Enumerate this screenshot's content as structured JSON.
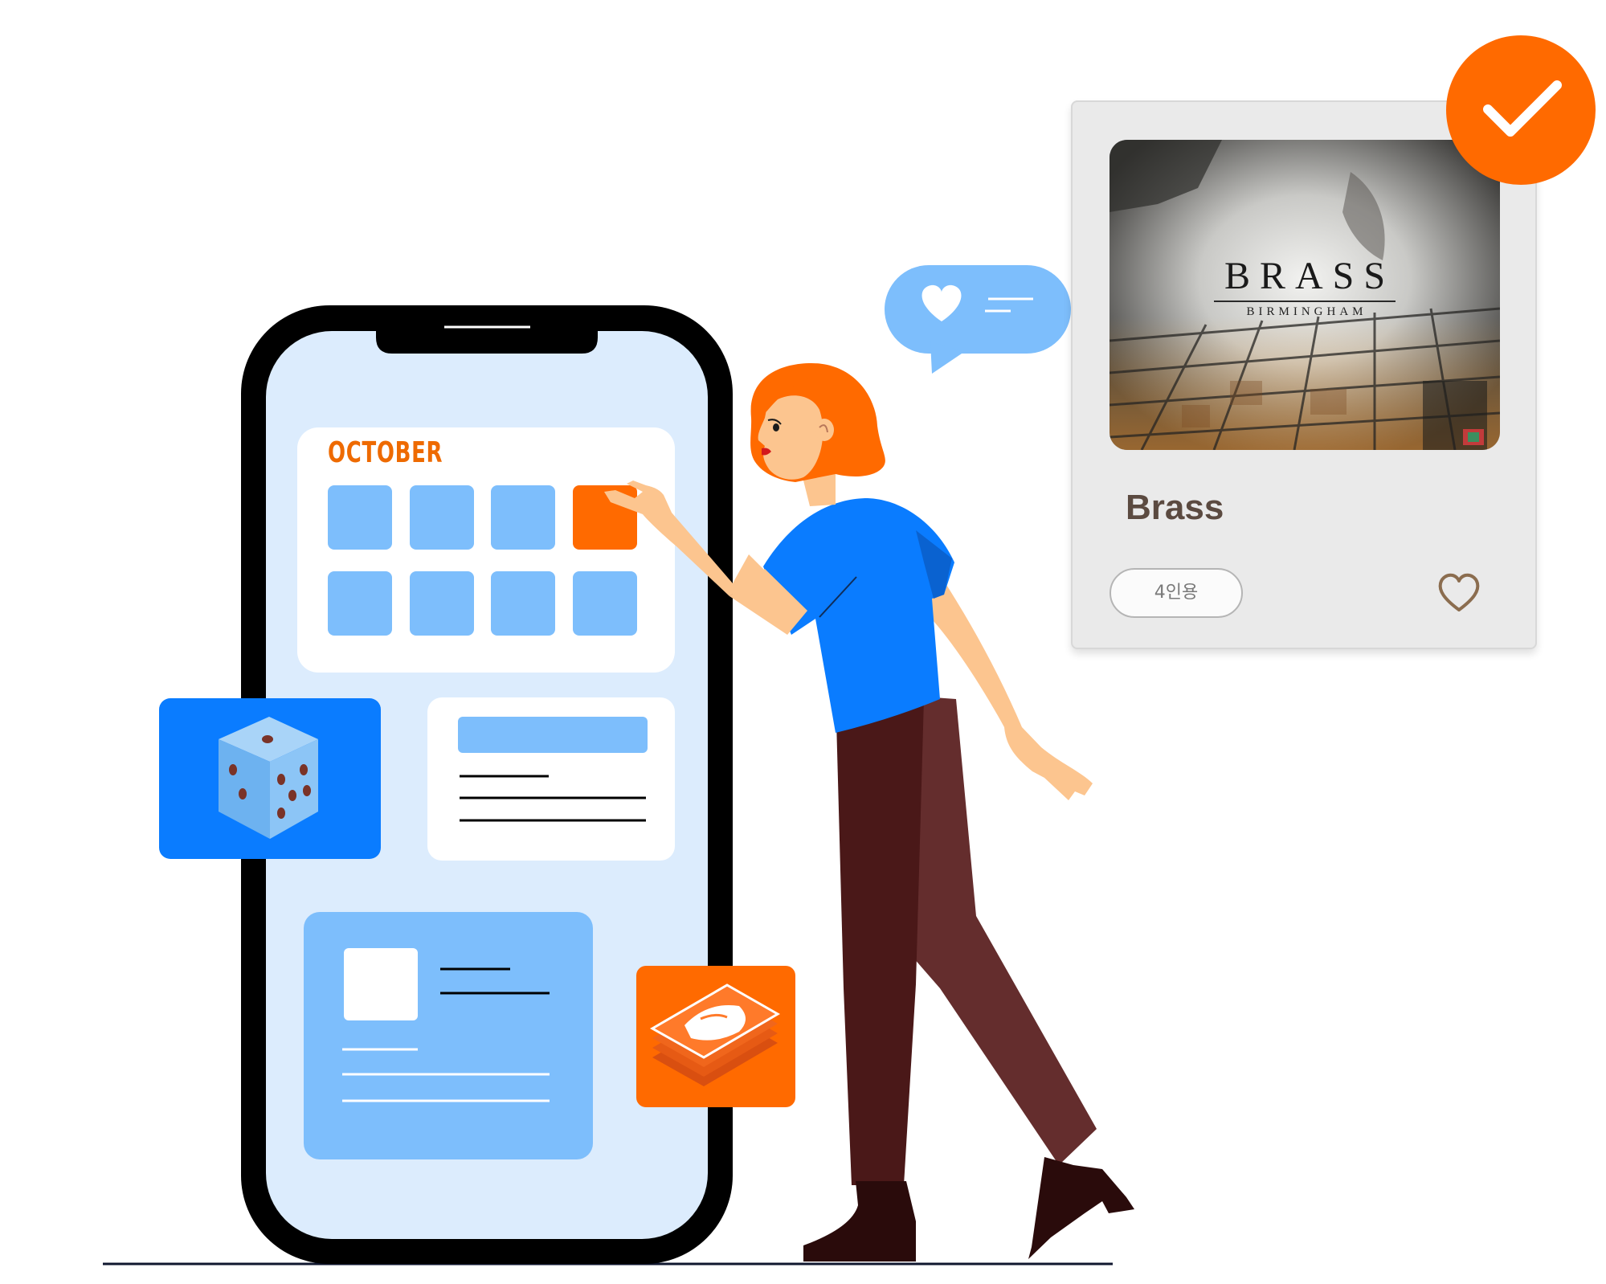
{
  "calendar": {
    "month_label": "OCTOBER",
    "highlight_color": "#ff6a00",
    "day_color": "#7dbefc"
  },
  "game_card": {
    "cover_title": "BRASS",
    "cover_subtitle": "BIRMINGHAM",
    "title": "Brass",
    "player_badge": "4인용",
    "favorite_icon": "heart-outline-icon",
    "selected_icon": "checkmark-icon"
  },
  "icons": {
    "dice": "dice-icon",
    "cards": "card-deck-icon",
    "chat": "heart-chat-bubble-icon"
  },
  "colors": {
    "accent_orange": "#ff6a00",
    "primary_blue": "#0a7cff",
    "light_blue": "#7dbefc",
    "screen_bg": "#dcecfd",
    "title_brown": "#5b4a40"
  }
}
